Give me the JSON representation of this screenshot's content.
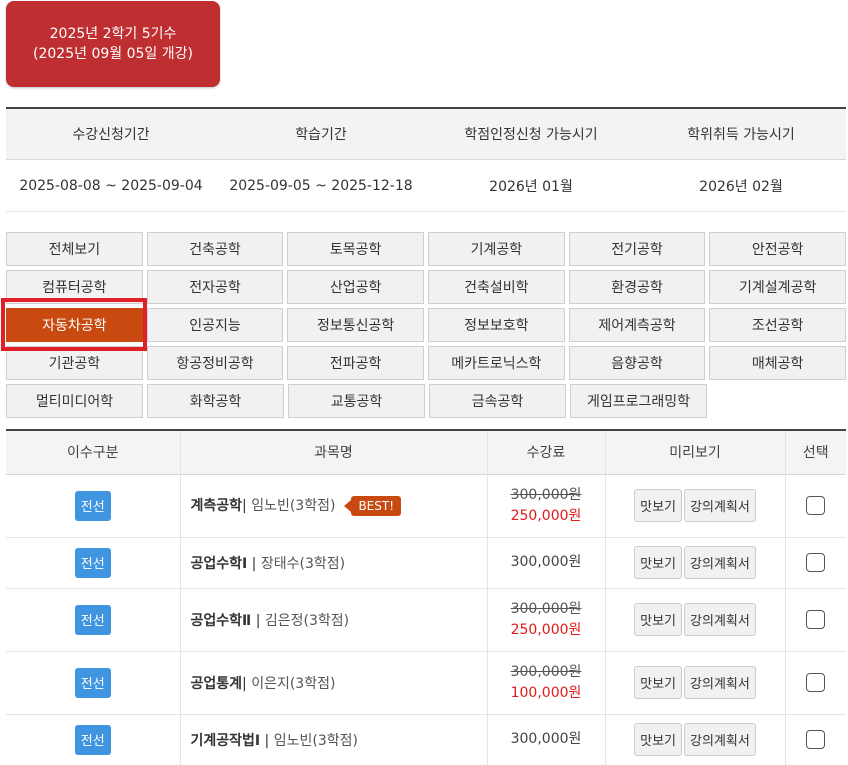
{
  "term": {
    "line1": "2025년 2학기 5기수",
    "line2": "(2025년 09월 05일 개강)"
  },
  "schedule": {
    "headers": [
      "수강신청기간",
      "학습기간",
      "학점인정신청 가능시기",
      "학위취득 가능시기"
    ],
    "values": [
      "2025-08-08 ~ 2025-09-04",
      "2025-09-05 ~ 2025-12-18",
      "2026년 01월",
      "2026년 02월"
    ]
  },
  "categories": {
    "active": "자동차공학",
    "rows": [
      [
        "전체보기",
        "건축공학",
        "토목공학",
        "기계공학",
        "전기공학",
        "안전공학"
      ],
      [
        "컴퓨터공학",
        "전자공학",
        "산업공학",
        "건축설비학",
        "환경공학",
        "기계설계공학"
      ],
      [
        "자동차공학",
        "인공지능",
        "정보통신공학",
        "정보보호학",
        "제어계측공학",
        "조선공학"
      ],
      [
        "기관공학",
        "항공정비공학",
        "전파공학",
        "메카트로닉스학",
        "음향공학",
        "매체공학"
      ],
      [
        "멀티미디어학",
        "화학공학",
        "교통공학",
        "금속공학",
        "게임프로그래밍학"
      ]
    ]
  },
  "table": {
    "headers": {
      "type": "이수구분",
      "name": "과목명",
      "fee": "수강료",
      "preview": "미리보기",
      "select": "선택"
    },
    "preview_label": "맛보기",
    "syllabus_label": "강의계획서",
    "best_label": "BEST!",
    "rows": [
      {
        "type": "전선",
        "title": "계측공학",
        "sep": "|",
        "prof": " 임노빈(3학점)",
        "best": true,
        "fee_old": "300,000원",
        "fee_new": "250,000원",
        "fee": "",
        "checked": false
      },
      {
        "type": "전선",
        "title": "공업수학Ⅰ",
        "sep": " | ",
        "prof": "장태수(3학점)",
        "best": false,
        "fee_old": "",
        "fee_new": "",
        "fee": "300,000원",
        "checked": false
      },
      {
        "type": "전선",
        "title": "공업수학Ⅱ",
        "sep": " | ",
        "prof": "김은정(3학점)",
        "best": false,
        "fee_old": "300,000원",
        "fee_new": "250,000원",
        "fee": "",
        "checked": false
      },
      {
        "type": "전선",
        "title": "공업통계",
        "sep": "|",
        "prof": " 이은지(3학점)",
        "best": false,
        "fee_old": "300,000원",
        "fee_new": "100,000원",
        "fee": "",
        "checked": false
      },
      {
        "type": "전선",
        "title": "기계공작법Ⅰ",
        "sep": " | ",
        "prof": "임노빈(3학점)",
        "best": false,
        "fee_old": "",
        "fee_new": "",
        "fee": "300,000원",
        "checked": false
      }
    ]
  },
  "colors": {
    "accent": "#c94a10",
    "term_bg": "#bf2f32",
    "badge_blue": "#3f95e0",
    "discount_red": "#e01b1b",
    "highlight_red": "#e01f26"
  }
}
